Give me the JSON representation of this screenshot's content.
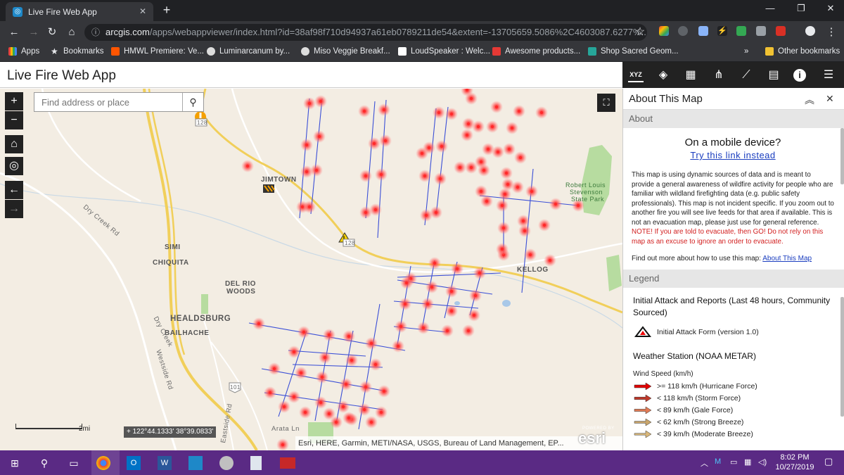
{
  "browser": {
    "tab_title": "Live Fire Web App",
    "new_tab": "+",
    "url_host": "arcgis.com",
    "url_path": "/apps/webappviewer/index.html?id=38af98f710d94937a61eb0789211de54&extent=-13705659.5086%2C4603087.6277%...",
    "bookmarks": [
      {
        "label": "Apps",
        "color": "#e8453c"
      },
      {
        "label": "Bookmarks",
        "color": "#e8eaed"
      },
      {
        "label": "HMWL Premiere: Ve...",
        "color": "#ff5500"
      },
      {
        "label": "Luminarcanum by...",
        "color": "#dddddd"
      },
      {
        "label": "Miso Veggie Breakf...",
        "color": "#dddddd"
      },
      {
        "label": "LoudSpeaker : Welc...",
        "color": "#ffffff"
      },
      {
        "label": "Awesome products...",
        "color": "#e53935"
      },
      {
        "label": "Shop Sacred Geom...",
        "color": "#26a69a"
      }
    ],
    "bookmarks_more": "»",
    "other_bookmarks": "Other bookmarks"
  },
  "app": {
    "title": "Live Fire Web App",
    "search_placeholder": "Find address or place",
    "tools": [
      "xyz-icon",
      "layers-icon",
      "basemap-gallery-icon",
      "share-icon",
      "measure-icon",
      "grid-icon",
      "info-icon",
      "menu-icon"
    ]
  },
  "map": {
    "places": {
      "jimtown": "JIMTOWN",
      "simi": "SIMI",
      "chiquita": "CHIQUITA",
      "del_rio": "DEL RIO",
      "woods": "WOODS",
      "healdsburg": "HEALDSBURG",
      "bailhache": "BAILHACHE",
      "kellog": "KELLOG",
      "park1": "Robert Louis",
      "park2": "Stevenson",
      "park3": "State Park",
      "dry_creek_rd": "Dry Creek Rd",
      "dry_creek": "Dry Creek",
      "westside_rd": "Westside Rd",
      "eastside_rd": "Eastside Rd",
      "arata_ln": "Arata Ln",
      "hwy128a": "128",
      "hwy128b": "128",
      "hwy101": "101"
    },
    "scale_label": "2mi",
    "coords": "122°44.1333' 38°39.0833'",
    "attribution": "Esri, HERE, Garmin, METI/NASA, USGS, Bureau of Land Management, EP...",
    "esri_logo": "esri",
    "esri_powered": "POWERED BY"
  },
  "panel": {
    "title": "About This Map",
    "about_section": "About",
    "mobile_question": "On a mobile device?",
    "mobile_link": "Try this link instead",
    "description": "This map is using dynamic sources of data and is meant to provide a general awareness of wildfire activity for people who are familiar with wildland firefighting data (e.g. public safety professionals). This map is not incident specific. If you zoom out to another fire you will see live feeds for that area if available. This is not an evacuation map, please just use for general reference.",
    "warning": "NOTE! If you are told to evacuate, then GO! Do not rely on this map as an excuse to ignore an order to evacuate.",
    "more_text": "Find out more about how to use this map:",
    "more_link": "About This Map",
    "legend_section": "Legend",
    "legend_group1": "Initial Attack and Reports (Last 48 hours, Community Sourced)",
    "legend_item1": "Initial Attack Form (version 1.0)",
    "legend_group2": "Weather Station (NOAA METAR)",
    "wind_title": "Wind Speed (km/h)",
    "wind_items": [
      {
        "label": ">= 118 km/h (Hurricane Force)",
        "color": "#e00000"
      },
      {
        "label": "< 118 km/h (Storm Force)",
        "color": "#c0392b"
      },
      {
        "label": "< 89 km/h (Gale Force)",
        "color": "#e07b55"
      },
      {
        "label": "< 62 km/h (Strong Breeze)",
        "color": "#c9a56b"
      },
      {
        "label": "< 39 km/h (Moderate Breeze)",
        "color": "#d9b77a"
      }
    ]
  },
  "taskbar": {
    "time": "8:02 PM",
    "date": "10/27/2019"
  }
}
